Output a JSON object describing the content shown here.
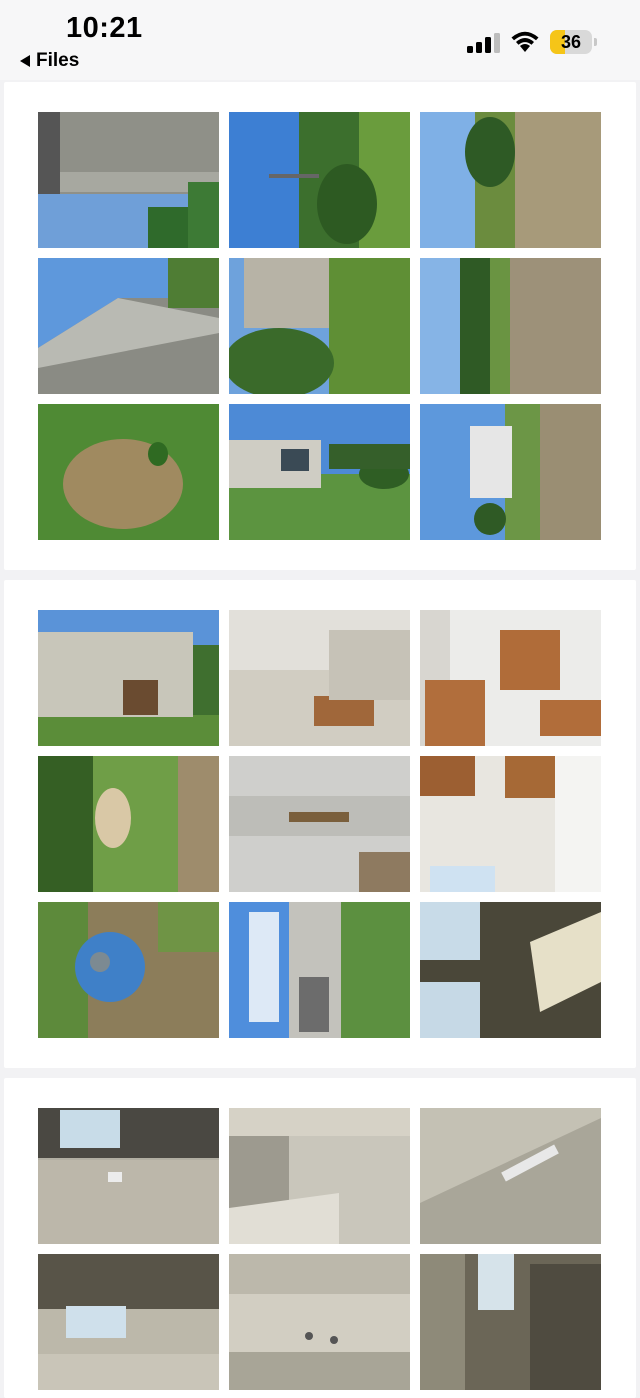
{
  "status_bar": {
    "time": "10:21",
    "back_label": "Files",
    "back_icon": "back-triangle-icon",
    "signal_icon": "cellular-signal-icon",
    "wifi_icon": "wifi-icon",
    "battery_level": "36",
    "battery_fraction": 0.36,
    "battery_color": "#f5c518"
  },
  "pages": [
    {
      "name": "scan-page-1",
      "photos": [
        "house-siding-corner-sky",
        "sky-pole-trees-yard",
        "sky-trees-dry-grass",
        "house-roof-corner-sky",
        "house-porch-shrub-lawn",
        "sky-tree-line-dry-grass",
        "grass-patch-closeup",
        "white-house-green-lawn",
        "white-house-tall-grass"
      ]
    },
    {
      "name": "scan-page-2",
      "photos": [
        "house-rear-steps-lawn",
        "interior-room-cabinet",
        "kitchen-cabinets-counter",
        "well-cover-in-grass",
        "siding-wall-closeup",
        "kitchen-cabinets-window",
        "blue-tank-lid-in-grass",
        "house-side-wall-sky",
        "dark-room-windows"
      ]
    },
    {
      "name": "scan-page-3",
      "photos": [
        "empty-room-window-door",
        "empty-room-vinyl-floor",
        "room-corner-vent",
        "room-window-doorway",
        "room-wall-outlet",
        "room-window-corner"
      ]
    }
  ]
}
